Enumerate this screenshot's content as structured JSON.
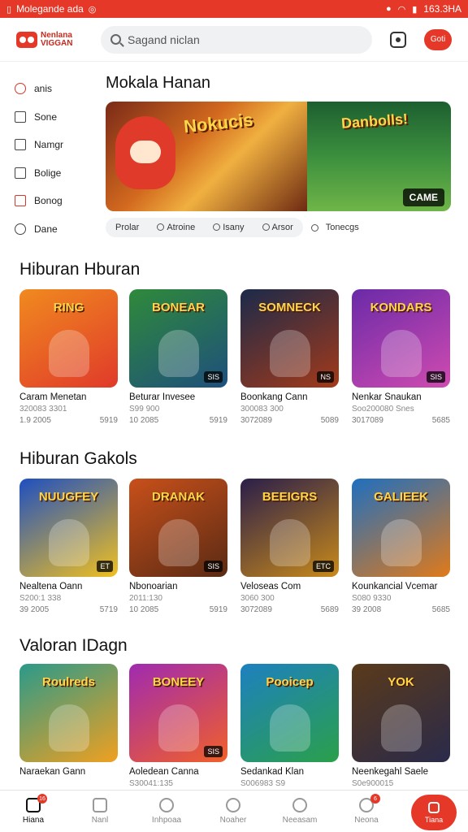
{
  "status_bar": {
    "left_text": "Molegande ada",
    "right_text": "163.3HA"
  },
  "header": {
    "logo_line1": "Nenlana",
    "logo_line2": "VIGGAN",
    "search_placeholder": "Sagand niclan",
    "action_label": "Goti"
  },
  "sidebar": {
    "items": [
      {
        "label": "anis",
        "icon": "person-icon"
      },
      {
        "label": "Sone",
        "icon": "play-icon"
      },
      {
        "label": "Namgr",
        "icon": "square-icon"
      },
      {
        "label": "Bolige",
        "icon": "briefcase-icon"
      },
      {
        "label": "Bonog",
        "icon": "calendar-icon"
      },
      {
        "label": "Dane",
        "icon": "chat-icon"
      }
    ]
  },
  "hero": {
    "title": "Mokala Hanan",
    "banner_left_text": "Nokucis",
    "banner_right_text": "Danbolls!",
    "badge": "CAME"
  },
  "chips": {
    "group": [
      "Prolar",
      "Atroine",
      "Isany",
      "Arsor"
    ],
    "solo": "Tonecgs"
  },
  "sections": [
    {
      "title": "Hiburan Hburan",
      "items": [
        {
          "name": "Caram Menetan",
          "sub": "320083 3301",
          "count": "1.9 2005",
          "views": "5919",
          "tag": "",
          "art": "RING",
          "bg": "#f08a1f",
          "bg2": "#e03a2a"
        },
        {
          "name": "Beturar Invesee",
          "sub": "S99 900",
          "count": "10 2085",
          "views": "5919",
          "tag": "SIS",
          "art": "BONEAR",
          "bg": "#2f8a3a",
          "bg2": "#1e4f7c"
        },
        {
          "name": "Boonkang Cann",
          "sub": "300083 300",
          "count": "3072089",
          "views": "5089",
          "tag": "NS",
          "art": "SOMNECK",
          "bg": "#1b2a4a",
          "bg2": "#a33a1a"
        },
        {
          "name": "Nenkar Snaukan",
          "sub": "Soo200080 Snes",
          "count": "3017089",
          "views": "5685",
          "tag": "SIS",
          "art": "KONDARS",
          "bg": "#6a2aa8",
          "bg2": "#d04bb0"
        }
      ]
    },
    {
      "title": "Hiburan Gakols",
      "items": [
        {
          "name": "Nealtena Oann",
          "sub": "S200:1 338",
          "count": "39 2005",
          "views": "5719",
          "tag": "ET",
          "art": "NUUGFEY",
          "bg": "#1e4fc0",
          "bg2": "#f0c020"
        },
        {
          "name": "Nbonoarian",
          "sub": "2011:130",
          "count": "10 2085",
          "views": "5919",
          "tag": "SIS",
          "art": "DRANAK",
          "bg": "#c8501a",
          "bg2": "#5a2a14"
        },
        {
          "name": "Veloseas Com",
          "sub": "3060 300",
          "count": "3072089",
          "views": "5689",
          "tag": "ETC",
          "art": "BEEIGRS",
          "bg": "#2a1e4a",
          "bg2": "#c88a1a"
        },
        {
          "name": "Kounkancial Vcemar",
          "sub": "S080 9330",
          "count": "39 2008",
          "views": "5685",
          "tag": "",
          "art": "GALIEEK",
          "bg": "#1e6fc0",
          "bg2": "#e07a1a"
        }
      ]
    },
    {
      "title": "Valoran IDagn",
      "items": [
        {
          "name": "Naraekan Gann",
          "sub": "",
          "count": "",
          "views": "",
          "tag": "",
          "art": "Roulreds",
          "bg": "#2a9a8a",
          "bg2": "#f0a020"
        },
        {
          "name": "Aoledean Canna",
          "sub": "S30041:135",
          "count": "",
          "views": "",
          "tag": "SIS",
          "art": "BONEEY",
          "bg": "#a02ab0",
          "bg2": "#f0602a"
        },
        {
          "name": "Sedankad Klan",
          "sub": "S006983 S9",
          "count": "",
          "views": "",
          "tag": "",
          "art": "Pooicep",
          "bg": "#1e80c0",
          "bg2": "#2aa04a"
        },
        {
          "name": "Neenkegahl Saele",
          "sub": "S0e900015",
          "count": "",
          "views": "",
          "tag": "",
          "art": "YOK",
          "bg": "#5a3a1a",
          "bg2": "#2a2a4a"
        }
      ]
    }
  ],
  "bottom_nav": {
    "items": [
      {
        "label": "Hiana",
        "badge": "16"
      },
      {
        "label": "Nanl",
        "badge": ""
      },
      {
        "label": "Inhpoaa",
        "badge": ""
      },
      {
        "label": "Noaher",
        "badge": ""
      },
      {
        "label": "Neeasam",
        "badge": ""
      },
      {
        "label": "Neona",
        "badge": "6"
      }
    ],
    "fab_label": "Tiana"
  },
  "colors": {
    "accent": "#e53828",
    "text": "#111111",
    "muted": "#888888"
  }
}
